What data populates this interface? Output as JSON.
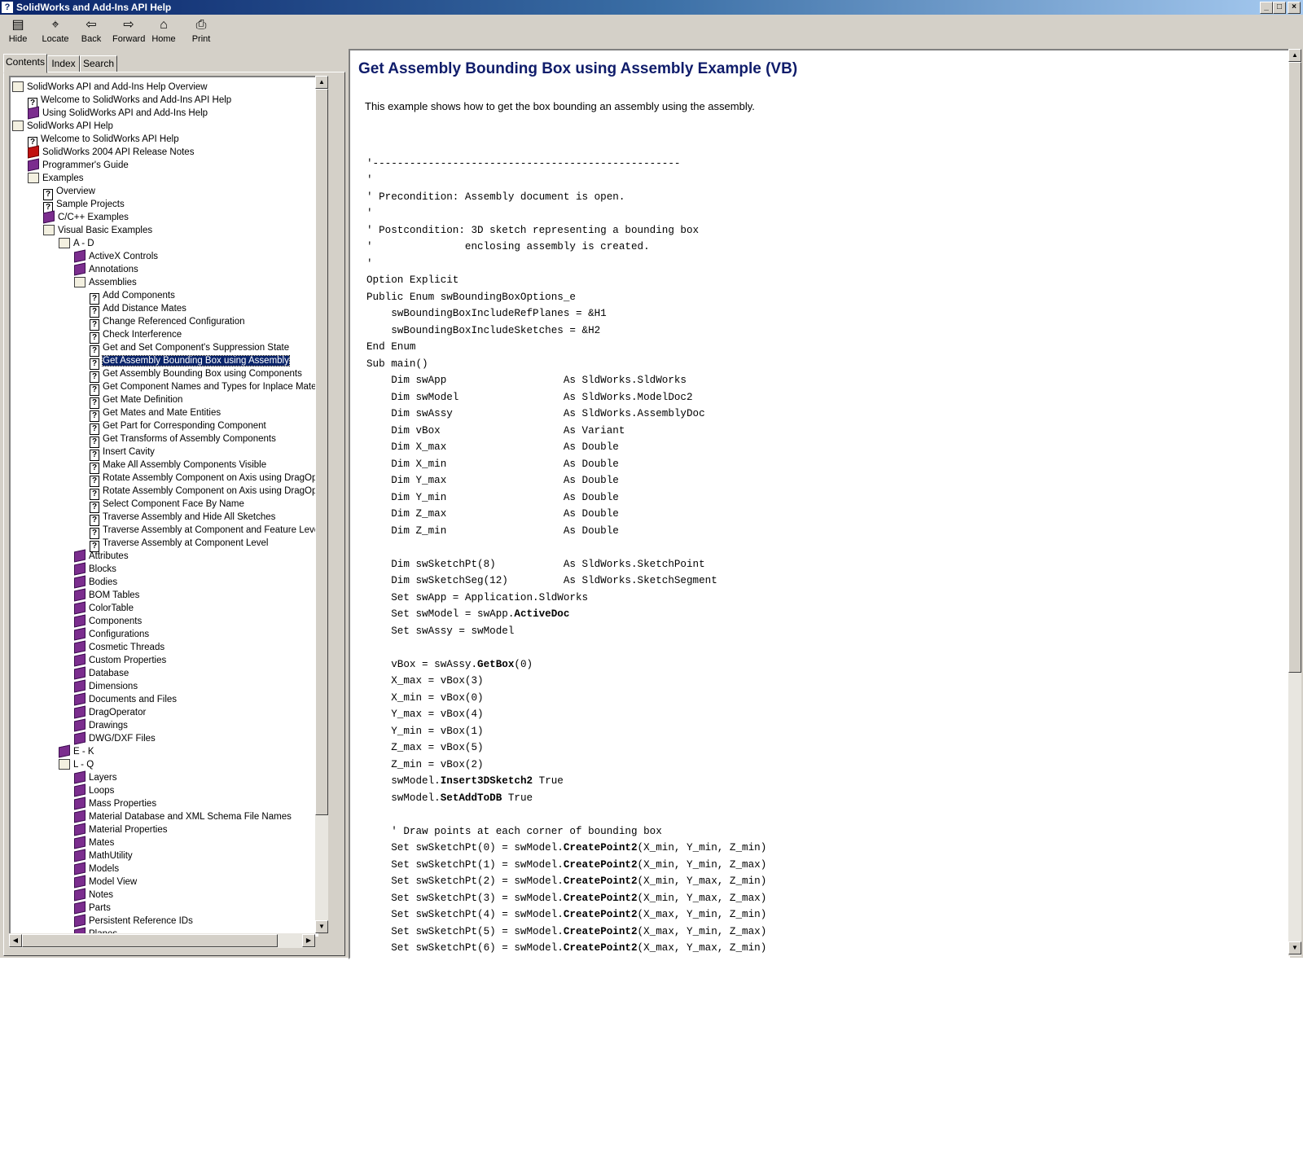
{
  "window": {
    "title": "SolidWorks and Add-Ins API Help"
  },
  "toolbar": [
    {
      "label": "Hide",
      "icon": "hide-icon"
    },
    {
      "label": "Locate",
      "icon": "locate-icon"
    },
    {
      "label": "Back",
      "icon": "back-arrow-icon"
    },
    {
      "label": "Forward",
      "icon": "forward-arrow-icon"
    },
    {
      "label": "Home",
      "icon": "home-icon"
    },
    {
      "label": "Print",
      "icon": "print-icon"
    }
  ],
  "tabs": [
    {
      "label": "Contents",
      "active": true
    },
    {
      "label": "Index"
    },
    {
      "label": "Search"
    }
  ],
  "tree": [
    {
      "label": "SolidWorks API and Add-Ins Help Overview",
      "icon": "open",
      "level": 0
    },
    {
      "label": "Welcome to SolidWorks and Add-Ins API Help",
      "icon": "page",
      "level": 1
    },
    {
      "label": "Using SolidWorks API and Add-Ins Help",
      "icon": "book",
      "level": 1
    },
    {
      "label": "SolidWorks API Help",
      "icon": "open",
      "level": 0
    },
    {
      "label": "Welcome to SolidWorks API Help",
      "icon": "page",
      "level": 1
    },
    {
      "label": "SolidWorks 2004 API Release Notes",
      "icon": "book-red",
      "level": 1
    },
    {
      "label": "Programmer's Guide",
      "icon": "book",
      "level": 1
    },
    {
      "label": "Examples",
      "icon": "open",
      "level": 1
    },
    {
      "label": "Overview",
      "icon": "page",
      "level": 2
    },
    {
      "label": "Sample Projects",
      "icon": "page",
      "level": 2
    },
    {
      "label": "C/C++ Examples",
      "icon": "book",
      "level": 2
    },
    {
      "label": "Visual Basic Examples",
      "icon": "open",
      "level": 2
    },
    {
      "label": "A - D",
      "icon": "open",
      "level": 3
    },
    {
      "label": "ActiveX Controls",
      "icon": "book",
      "level": 4
    },
    {
      "label": "Annotations",
      "icon": "book",
      "level": 4
    },
    {
      "label": "Assemblies",
      "icon": "open",
      "level": 4
    },
    {
      "label": "Add Components",
      "icon": "page",
      "level": 5
    },
    {
      "label": "Add Distance Mates",
      "icon": "page",
      "level": 5
    },
    {
      "label": "Change Referenced Configuration",
      "icon": "page",
      "level": 5
    },
    {
      "label": "Check Interference",
      "icon": "page",
      "level": 5
    },
    {
      "label": "Get and Set Component's Suppression State",
      "icon": "page",
      "level": 5
    },
    {
      "label": "Get Assembly Bounding Box using Assembly",
      "icon": "page",
      "level": 5,
      "selected": true
    },
    {
      "label": "Get Assembly Bounding Box using Components",
      "icon": "page",
      "level": 5
    },
    {
      "label": "Get Component Names and Types for Inplace Mate",
      "icon": "page",
      "level": 5
    },
    {
      "label": "Get Mate Definition",
      "icon": "page",
      "level": 5
    },
    {
      "label": "Get Mates and Mate Entities",
      "icon": "page",
      "level": 5
    },
    {
      "label": "Get Part for Corresponding Component",
      "icon": "page",
      "level": 5
    },
    {
      "label": "Get Transforms of Assembly Components",
      "icon": "page",
      "level": 5
    },
    {
      "label": "Insert Cavity",
      "icon": "page",
      "level": 5
    },
    {
      "label": "Make All Assembly Components Visible",
      "icon": "page",
      "level": 5
    },
    {
      "label": "Rotate Assembly Component on Axis using DragOperato",
      "icon": "page",
      "level": 5
    },
    {
      "label": "Rotate Assembly Component on Axis using DragOperato",
      "icon": "page",
      "level": 5
    },
    {
      "label": "Select Component Face By Name",
      "icon": "page",
      "level": 5
    },
    {
      "label": "Traverse Assembly and Hide All Sketches",
      "icon": "page",
      "level": 5
    },
    {
      "label": "Traverse Assembly at Component and Feature Levels",
      "icon": "page",
      "level": 5
    },
    {
      "label": "Traverse Assembly at Component Level",
      "icon": "page",
      "level": 5
    },
    {
      "label": "Attributes",
      "icon": "book",
      "level": 4
    },
    {
      "label": "Blocks",
      "icon": "book",
      "level": 4
    },
    {
      "label": "Bodies",
      "icon": "book",
      "level": 4
    },
    {
      "label": "BOM Tables",
      "icon": "book",
      "level": 4
    },
    {
      "label": "ColorTable",
      "icon": "book",
      "level": 4
    },
    {
      "label": "Components",
      "icon": "book",
      "level": 4
    },
    {
      "label": "Configurations",
      "icon": "book",
      "level": 4
    },
    {
      "label": "Cosmetic Threads",
      "icon": "book",
      "level": 4
    },
    {
      "label": "Custom Properties",
      "icon": "book",
      "level": 4
    },
    {
      "label": "Database",
      "icon": "book",
      "level": 4
    },
    {
      "label": "Dimensions",
      "icon": "book",
      "level": 4
    },
    {
      "label": "Documents and Files",
      "icon": "book",
      "level": 4
    },
    {
      "label": "DragOperator",
      "icon": "book",
      "level": 4
    },
    {
      "label": "Drawings",
      "icon": "book",
      "level": 4
    },
    {
      "label": "DWG/DXF Files",
      "icon": "book",
      "level": 4
    },
    {
      "label": "E - K",
      "icon": "book",
      "level": 3
    },
    {
      "label": "L - Q",
      "icon": "open",
      "level": 3
    },
    {
      "label": "Layers",
      "icon": "book",
      "level": 4
    },
    {
      "label": "Loops",
      "icon": "book",
      "level": 4
    },
    {
      "label": "Mass Properties",
      "icon": "book",
      "level": 4
    },
    {
      "label": "Material Database and XML Schema File Names",
      "icon": "book",
      "level": 4
    },
    {
      "label": "Material Properties",
      "icon": "book",
      "level": 4
    },
    {
      "label": "Mates",
      "icon": "book",
      "level": 4
    },
    {
      "label": "MathUtility",
      "icon": "book",
      "level": 4
    },
    {
      "label": "Models",
      "icon": "book",
      "level": 4
    },
    {
      "label": "Model View",
      "icon": "book",
      "level": 4
    },
    {
      "label": "Notes",
      "icon": "book",
      "level": 4
    },
    {
      "label": "Parts",
      "icon": "book",
      "level": 4
    },
    {
      "label": "Persistent Reference IDs",
      "icon": "book",
      "level": 4
    },
    {
      "label": "Planes",
      "icon": "book",
      "level": 4
    }
  ],
  "content": {
    "heading": "Get Assembly Bounding Box using Assembly Example (VB)",
    "intro": "This example shows how to get the box bounding an assembly using the assembly.",
    "code": [
      [
        ""
      ],
      [
        "'--------------------------------------------------"
      ],
      [
        "'"
      ],
      [
        "' Precondition: Assembly document is open."
      ],
      [
        "'"
      ],
      [
        "' Postcondition: 3D sketch representing a bounding box"
      ],
      [
        "'               enclosing assembly is created."
      ],
      [
        "'"
      ],
      [
        "Option Explicit"
      ],
      [
        "Public Enum swBoundingBoxOptions_e"
      ],
      [
        "    swBoundingBoxIncludeRefPlanes = &H1"
      ],
      [
        "    swBoundingBoxIncludeSketches = &H2"
      ],
      [
        "End Enum"
      ],
      [
        "Sub main()"
      ],
      [
        "    Dim swApp                   As SldWorks.SldWorks"
      ],
      [
        "    Dim swModel                 As SldWorks.ModelDoc2"
      ],
      [
        "    Dim swAssy                  As SldWorks.AssemblyDoc"
      ],
      [
        "    Dim vBox                    As Variant"
      ],
      [
        "    Dim X_max                   As Double"
      ],
      [
        "    Dim X_min                   As Double"
      ],
      [
        "    Dim Y_max                   As Double"
      ],
      [
        "    Dim Y_min                   As Double"
      ],
      [
        "    Dim Z_max                   As Double"
      ],
      [
        "    Dim Z_min                   As Double"
      ],
      [
        ""
      ],
      [
        "    Dim swSketchPt(8)           As SldWorks.SketchPoint"
      ],
      [
        "    Dim swSketchSeg(12)         As SldWorks.SketchSegment"
      ],
      [
        "    Set swApp = Application.SldWorks"
      ],
      [
        "    Set swModel = swApp.",
        "ActiveDoc",
        ""
      ],
      [
        "    Set swAssy = swModel"
      ],
      [
        ""
      ],
      [
        "    vBox = swAssy.",
        "GetBox",
        "(0)"
      ],
      [
        "    X_max = vBox(3)"
      ],
      [
        "    X_min = vBox(0)"
      ],
      [
        "    Y_max = vBox(4)"
      ],
      [
        "    Y_min = vBox(1)"
      ],
      [
        "    Z_max = vBox(5)"
      ],
      [
        "    Z_min = vBox(2)"
      ],
      [
        "    swModel.",
        "Insert3DSketch2",
        " True"
      ],
      [
        "    swModel.",
        "SetAddToDB",
        " True"
      ],
      [
        ""
      ],
      [
        "    ' Draw points at each corner of bounding box"
      ],
      [
        "    Set swSketchPt(0) = swModel.",
        "CreatePoint2",
        "(X_min, Y_min, Z_min)"
      ],
      [
        "    Set swSketchPt(1) = swModel.",
        "CreatePoint2",
        "(X_min, Y_min, Z_max)"
      ],
      [
        "    Set swSketchPt(2) = swModel.",
        "CreatePoint2",
        "(X_min, Y_max, Z_min)"
      ],
      [
        "    Set swSketchPt(3) = swModel.",
        "CreatePoint2",
        "(X_min, Y_max, Z_max)"
      ],
      [
        "    Set swSketchPt(4) = swModel.",
        "CreatePoint2",
        "(X_max, Y_min, Z_min)"
      ],
      [
        "    Set swSketchPt(5) = swModel.",
        "CreatePoint2",
        "(X_max, Y_min, Z_max)"
      ],
      [
        "    Set swSketchPt(6) = swModel.",
        "CreatePoint2",
        "(X_max, Y_max, Z_min)"
      ]
    ]
  }
}
